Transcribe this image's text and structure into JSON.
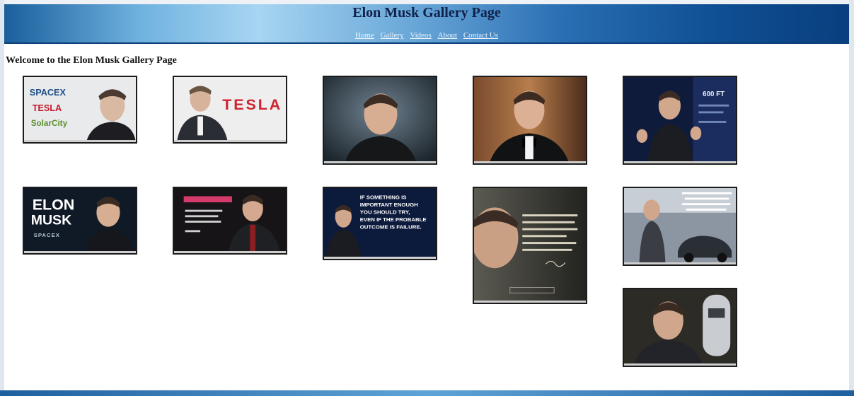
{
  "page": {
    "title": "Elon Musk Gallery Page",
    "nav": [
      "Home",
      "Gallery",
      "Videos",
      "About",
      "Contact Us"
    ],
    "welcome": "Welcome to the Elon Musk Gallery Page"
  },
  "thumbnails": [
    {
      "label_lines": [
        "SPACEX",
        "TESLA",
        "SolarCity"
      ]
    },
    {
      "label_lines": [
        "TESLA"
      ]
    },
    {
      "label_lines": []
    },
    {
      "label_lines": []
    },
    {
      "label_lines": [
        "600 FT"
      ]
    },
    {
      "label_lines": [
        "ELON",
        "MUSK",
        "SPACEX"
      ]
    },
    {
      "label_lines": []
    },
    {
      "label_lines": [
        "IF SOMETHING IS",
        "IMPORTANT ENOUGH",
        "YOU SHOULD TRY,",
        "EVEN IF THE PROBABLE",
        "OUTCOME IS FAILURE."
      ]
    },
    {
      "label_lines": []
    },
    {
      "label_lines": []
    },
    {
      "label_lines": []
    }
  ],
  "colors": {
    "banner_dark": "#0a3f7e",
    "banner_light": "#a7d5f2",
    "title": "#10214a",
    "nav_link": "#eaf4ff",
    "thumb_border": "#1c1c1c"
  }
}
